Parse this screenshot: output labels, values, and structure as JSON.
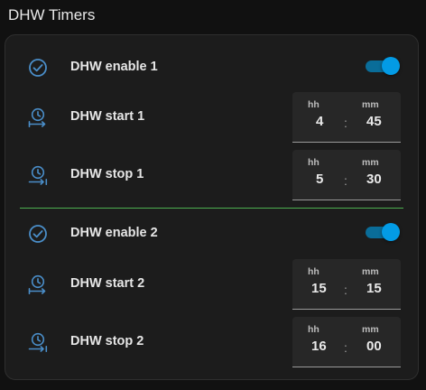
{
  "section": {
    "title": "DHW Timers"
  },
  "rows": [
    {
      "label": "DHW enable 1",
      "icon": "check-circle-icon",
      "toggle_on": true
    },
    {
      "label": "DHW start 1",
      "icon": "clock-start-icon",
      "hh_label": "hh",
      "mm_label": "mm",
      "hh": "4",
      "sep": ":",
      "mm": "45"
    },
    {
      "label": "DHW stop 1",
      "icon": "clock-end-icon",
      "hh_label": "hh",
      "mm_label": "mm",
      "hh": "5",
      "sep": ":",
      "mm": "30"
    },
    {
      "label": "DHW enable 2",
      "icon": "check-circle-icon",
      "toggle_on": true
    },
    {
      "label": "DHW start 2",
      "icon": "clock-start-icon",
      "hh_label": "hh",
      "mm_label": "mm",
      "hh": "15",
      "sep": ":",
      "mm": "15"
    },
    {
      "label": "DHW stop 2",
      "icon": "clock-end-icon",
      "hh_label": "hh",
      "mm_label": "mm",
      "hh": "16",
      "sep": ":",
      "mm": "00"
    }
  ],
  "colors": {
    "accent": "#039be5",
    "divider": "#4caf50",
    "icon": "#4a8ec9",
    "card": "#1c1c1c"
  }
}
